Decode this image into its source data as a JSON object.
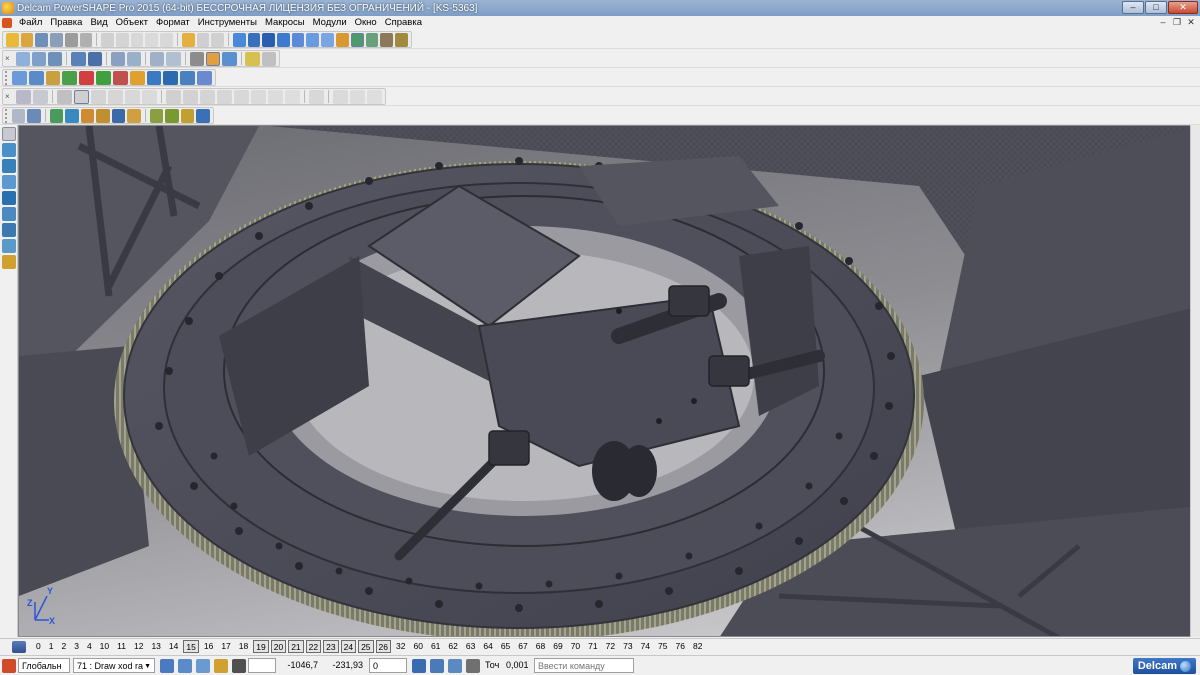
{
  "window": {
    "title": "Delcam PowerSHAPE Pro 2015 (64-bit) БЕССРОЧНАЯ ЛИЦЕНЗИЯ БЕЗ ОГРАНИЧЕНИЙ - [KS-5363]",
    "minimize": "–",
    "maximize": "□",
    "close": "✕"
  },
  "menu": {
    "items": [
      "Файл",
      "Правка",
      "Вид",
      "Объект",
      "Формат",
      "Инструменты",
      "Макросы",
      "Модули",
      "Окно",
      "Справка"
    ],
    "mdi_minimize": "–",
    "mdi_restore": "❐",
    "mdi_close": "✕"
  },
  "toolbars": {
    "close_glyph": "×"
  },
  "viewport": {
    "model_name": "KS-5363",
    "axis_labels": {
      "y": "Y",
      "z": "Z",
      "x": "X"
    }
  },
  "levels": {
    "items": [
      {
        "label": "0",
        "active": false
      },
      {
        "label": "1",
        "active": false
      },
      {
        "label": "2",
        "active": false
      },
      {
        "label": "3",
        "active": false
      },
      {
        "label": "4",
        "active": false
      },
      {
        "label": "10",
        "active": false
      },
      {
        "label": "11",
        "active": false
      },
      {
        "label": "12",
        "active": false
      },
      {
        "label": "13",
        "active": false
      },
      {
        "label": "14",
        "active": false
      },
      {
        "label": "15",
        "active": true
      },
      {
        "label": "16",
        "active": false
      },
      {
        "label": "17",
        "active": false
      },
      {
        "label": "18",
        "active": false
      },
      {
        "label": "19",
        "active": true
      },
      {
        "label": "20",
        "active": true
      },
      {
        "label": "21",
        "active": true
      },
      {
        "label": "22",
        "active": true
      },
      {
        "label": "23",
        "active": true
      },
      {
        "label": "24",
        "active": true
      },
      {
        "label": "25",
        "active": true
      },
      {
        "label": "26",
        "active": true
      },
      {
        "label": "32",
        "active": false
      },
      {
        "label": "60",
        "active": false
      },
      {
        "label": "61",
        "active": false
      },
      {
        "label": "62",
        "active": false
      },
      {
        "label": "63",
        "active": false
      },
      {
        "label": "64",
        "active": false
      },
      {
        "label": "65",
        "active": false
      },
      {
        "label": "67",
        "active": false
      },
      {
        "label": "68",
        "active": false
      },
      {
        "label": "69",
        "active": false
      },
      {
        "label": "70",
        "active": false
      },
      {
        "label": "71",
        "active": false
      },
      {
        "label": "72",
        "active": false
      },
      {
        "label": "73",
        "active": false
      },
      {
        "label": "74",
        "active": false
      },
      {
        "label": "75",
        "active": false
      },
      {
        "label": "76",
        "active": false
      },
      {
        "label": "82",
        "active": false
      }
    ]
  },
  "status": {
    "workplane": "Глобальн",
    "level_selector": "71 : Draw xod ra",
    "coord_x": "-1046,7",
    "coord_y": "-231,93",
    "coord_z": "0",
    "tolerance_label": "Точ",
    "tolerance_value": "0,001",
    "command_placeholder": "Ввести команду",
    "brand": "Delcam",
    "dropdown_glyph": "▼"
  },
  "colors": {
    "titlebar": "#7f9ec5",
    "model_gray": "#4a4a56",
    "teeth": "#8f8f7a",
    "brand_blue": "#1f4f9e"
  }
}
